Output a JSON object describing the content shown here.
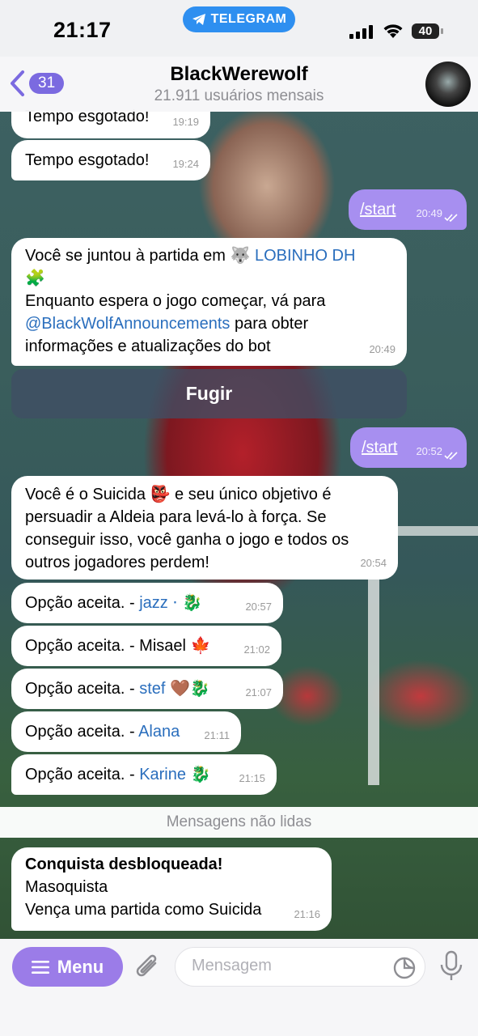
{
  "status": {
    "time": "21:17",
    "app_pill": "TELEGRAM",
    "battery": "40"
  },
  "header": {
    "back_count": "31",
    "title": "BlackWerewolf",
    "subtitle": "21.911 usuários mensais"
  },
  "messages": [
    {
      "text": "Tempo esgotado!",
      "time": "19:19"
    },
    {
      "text": "Tempo esgotado!",
      "time": "19:24"
    },
    {
      "text": "/start",
      "time": "20:49"
    },
    {
      "part1": "Você se juntou à partida em",
      "emoji1": "🐺",
      "group": "LOBINHO DH",
      "emoji2": "🧩",
      "line2": "Enquanto espera o jogo começar, vá para",
      "mention": "@BlackWolfAnnouncements",
      "part3": "para obter",
      "line4": "informações e atualizações do bot",
      "time": "20:49"
    },
    {
      "text": "/start",
      "time": "20:52"
    },
    {
      "part1": "Você é o Suicida",
      "emoji": "👺",
      "part2": "e seu único objetivo é persuadir a Aldeia para levá-lo à força. Se conseguir isso, você ganha o jogo e todos os outros jogadores perdem!",
      "time": "20:54"
    },
    {
      "prefix": "Opção aceita. -",
      "name": "jazz",
      "extra": "⋅",
      "emoji": "🐉",
      "time": "20:57"
    },
    {
      "prefix": "Opção aceita. - Misael",
      "emoji": "🍁",
      "time": "21:02"
    },
    {
      "prefix": "Opção aceita. -",
      "name": "stef",
      "emoji": "🤎🐉",
      "time": "21:07"
    },
    {
      "prefix": "Opção aceita. -",
      "name": "Alana",
      "time": "21:11"
    },
    {
      "prefix": "Opção aceita. -",
      "name": "Karine",
      "emoji": "🐉",
      "time": "21:15"
    },
    {
      "title": "Conquista desbloqueada!",
      "line2": "Masoquista",
      "line3": "Vença uma partida como Suicida",
      "time": "21:16"
    }
  ],
  "keyboard": {
    "button": "Fugir"
  },
  "unread_label": "Mensagens não lidas",
  "input": {
    "menu_label": "Menu",
    "placeholder": "Mensagem"
  }
}
